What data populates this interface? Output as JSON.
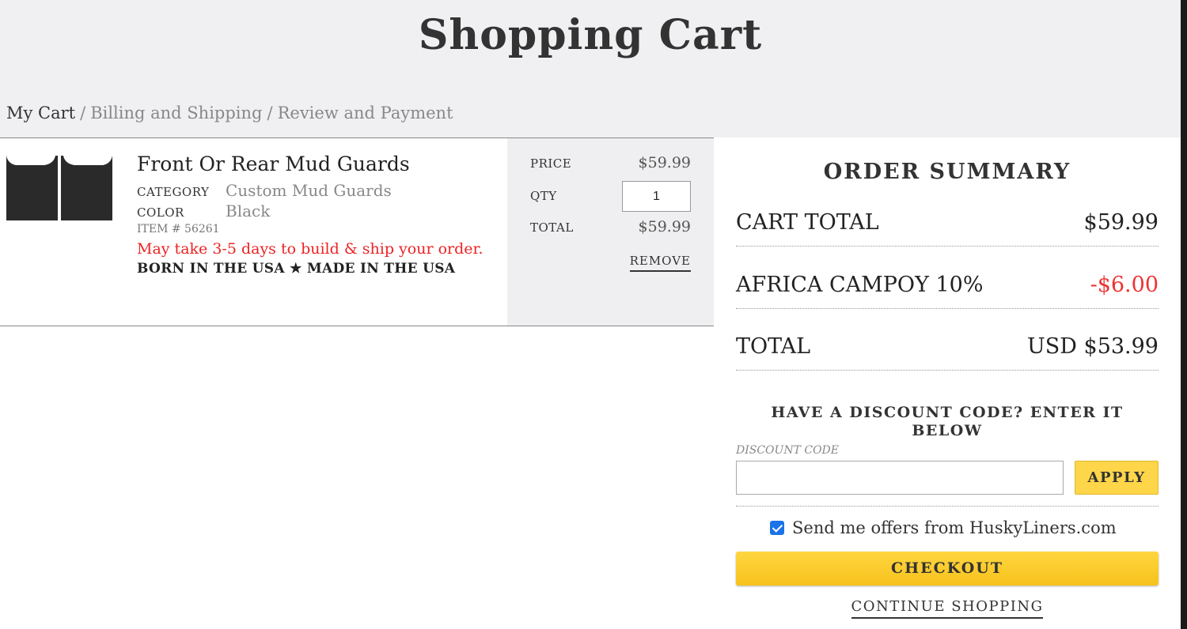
{
  "page": {
    "title": "Shopping Cart"
  },
  "breadcrumb": {
    "steps": [
      "My Cart",
      "Billing and Shipping",
      "Review and Payment"
    ],
    "separator": "/"
  },
  "cart_item": {
    "name": "Front Or Rear Mud Guards",
    "category_label": "CATEGORY",
    "category": "Custom Mud Guards",
    "color_label": "COLOR",
    "color": "Black",
    "item_number": "ITEM # 56261",
    "lead_time": "May take 3-5 days to build & ship your order.",
    "tagline": "BORN IN THE USA ★ MADE IN THE USA",
    "price_label": "PRICE",
    "price": "$59.99",
    "qty_label": "QTY",
    "qty": "1",
    "total_label": "TOTAL",
    "total": "$59.99",
    "remove_label": "REMOVE"
  },
  "order_summary": {
    "title": "ORDER SUMMARY",
    "rows": [
      {
        "label": "CART TOTAL",
        "value": "$59.99"
      },
      {
        "label": "AFRICA CAMPOY 10%",
        "value": "-$6.00"
      },
      {
        "label": "TOTAL",
        "value": "USD $53.99"
      }
    ],
    "discount_prompt": "HAVE A DISCOUNT CODE? ENTER IT BELOW",
    "discount_label": "DISCOUNT CODE",
    "discount_value": "",
    "apply_label": "APPLY",
    "offers_label": "Send me offers from HuskyLiners.com",
    "offers_checked": true,
    "checkout_label": "CHECKOUT",
    "continue_label": "CONTINUE SHOPPING"
  },
  "colors": {
    "header_bg": "#f0f0f2",
    "accent_yellow": "#f6c21c",
    "alert_red": "#e22222"
  }
}
